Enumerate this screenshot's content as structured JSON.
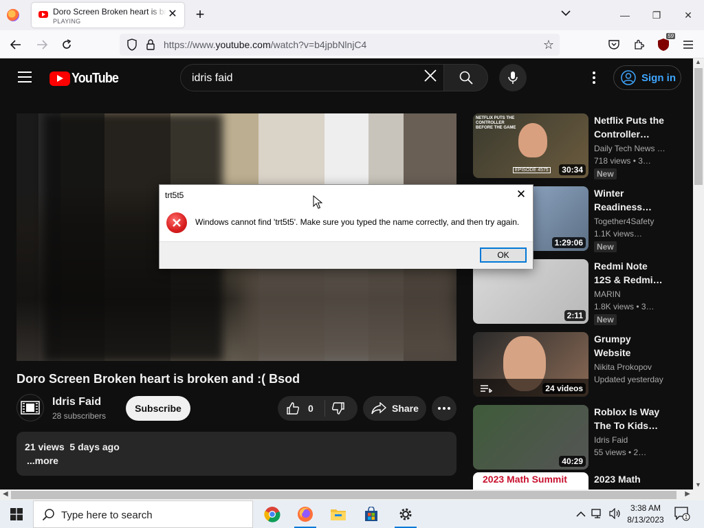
{
  "browser": {
    "tab": {
      "title": "Doro Screen Broken heart is broken and :( Bsod",
      "status": "PLAYING"
    },
    "url_prefix": "https://www.",
    "url_domain": "youtube.com",
    "url_path": "/watch?v=b4jpbNlnjC4",
    "extension_badge": "59"
  },
  "youtube": {
    "logo_text": "YouTube",
    "search_value": "idris faid",
    "sign_in_label": "Sign in",
    "video": {
      "title": "Doro Screen Broken heart is broken and :( Bsod",
      "channel": "Idris Faid",
      "subscribers": "28 subscribers",
      "subscribe_label": "Subscribe",
      "likes": "0",
      "share_label": "Share",
      "views": "21 views",
      "age": "5 days ago",
      "more_label": "...more"
    },
    "recommendations": [
      {
        "title1": "Netflix Puts the",
        "title2": "Controller…",
        "channel": "Daily Tech News …",
        "meta": "718 views  • 3…",
        "badge": "New",
        "duration": "30:34",
        "thumb_text": "NETFLIX PUTS THE CONTROLLER BEFORE THE GAME",
        "thumb_tag": "EPISODE 4575",
        "colors": [
          "#3a3a2e",
          "#6b5b3e"
        ]
      },
      {
        "title1": "Winter",
        "title2": "Readiness…",
        "channel": "Together4Safety",
        "meta": "1.1K views…",
        "badge": "New",
        "duration": "1:29:06",
        "colors": [
          "#9fb8d8",
          "#5c6f84"
        ]
      },
      {
        "title1": "Redmi Note",
        "title2": "12S & Redmi…",
        "channel": "MARIN",
        "meta": "1.8K views  • 3…",
        "badge": "New",
        "duration": "2:11",
        "colors": [
          "#d9d9d9",
          "#b8b8b8"
        ]
      },
      {
        "title1": "Grumpy",
        "title2": "Website",
        "channel": "Nikita Prokopov",
        "meta": "Updated yesterday",
        "badge": "",
        "duration": "24 videos",
        "colors": [
          "#2a2a2a",
          "#8a6a55"
        ]
      },
      {
        "title1": "Roblox Is Way",
        "title2": "The To Kids…",
        "channel": "Idris Faid",
        "meta": "55 views  • 2…",
        "badge": "",
        "duration": "40:29",
        "colors": [
          "#3f5b3a",
          "#555"
        ]
      },
      {
        "title1": "2023 Math",
        "title2": "",
        "channel": "",
        "meta": "",
        "badge": "",
        "duration": "",
        "thumb_text": "2023 Math Summit",
        "colors": [
          "#ffffff",
          "#ffffff"
        ]
      }
    ]
  },
  "dialog": {
    "title": "trt5t5",
    "message": "Windows cannot find 'trt5t5'. Make sure you typed the name correctly, and then try again.",
    "ok_label": "OK"
  },
  "taskbar": {
    "search_placeholder": "Type here to search",
    "time": "3:38 AM",
    "date": "8/13/2023",
    "notification_count": "1",
    "pinned": [
      "chrome-icon",
      "firefox-icon",
      "file-explorer-icon",
      "store-icon",
      "settings-icon"
    ]
  }
}
